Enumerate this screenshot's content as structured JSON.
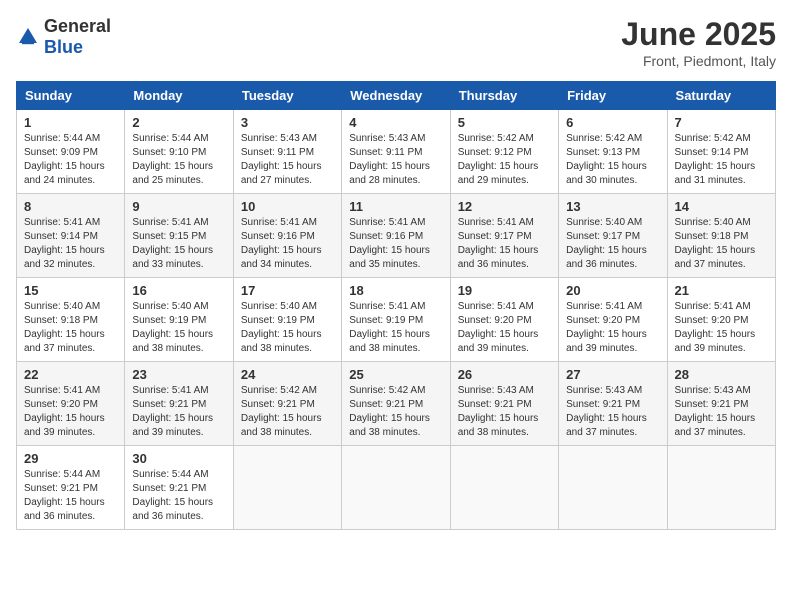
{
  "header": {
    "logo_general": "General",
    "logo_blue": "Blue",
    "month_title": "June 2025",
    "subtitle": "Front, Piedmont, Italy"
  },
  "days_of_week": [
    "Sunday",
    "Monday",
    "Tuesday",
    "Wednesday",
    "Thursday",
    "Friday",
    "Saturday"
  ],
  "weeks": [
    [
      {
        "day": "1",
        "sunrise": "5:44 AM",
        "sunset": "9:09 PM",
        "daylight": "15 hours and 24 minutes."
      },
      {
        "day": "2",
        "sunrise": "5:44 AM",
        "sunset": "9:10 PM",
        "daylight": "15 hours and 25 minutes."
      },
      {
        "day": "3",
        "sunrise": "5:43 AM",
        "sunset": "9:11 PM",
        "daylight": "15 hours and 27 minutes."
      },
      {
        "day": "4",
        "sunrise": "5:43 AM",
        "sunset": "9:11 PM",
        "daylight": "15 hours and 28 minutes."
      },
      {
        "day": "5",
        "sunrise": "5:42 AM",
        "sunset": "9:12 PM",
        "daylight": "15 hours and 29 minutes."
      },
      {
        "day": "6",
        "sunrise": "5:42 AM",
        "sunset": "9:13 PM",
        "daylight": "15 hours and 30 minutes."
      },
      {
        "day": "7",
        "sunrise": "5:42 AM",
        "sunset": "9:14 PM",
        "daylight": "15 hours and 31 minutes."
      }
    ],
    [
      {
        "day": "8",
        "sunrise": "5:41 AM",
        "sunset": "9:14 PM",
        "daylight": "15 hours and 32 minutes."
      },
      {
        "day": "9",
        "sunrise": "5:41 AM",
        "sunset": "9:15 PM",
        "daylight": "15 hours and 33 minutes."
      },
      {
        "day": "10",
        "sunrise": "5:41 AM",
        "sunset": "9:16 PM",
        "daylight": "15 hours and 34 minutes."
      },
      {
        "day": "11",
        "sunrise": "5:41 AM",
        "sunset": "9:16 PM",
        "daylight": "15 hours and 35 minutes."
      },
      {
        "day": "12",
        "sunrise": "5:41 AM",
        "sunset": "9:17 PM",
        "daylight": "15 hours and 36 minutes."
      },
      {
        "day": "13",
        "sunrise": "5:40 AM",
        "sunset": "9:17 PM",
        "daylight": "15 hours and 36 minutes."
      },
      {
        "day": "14",
        "sunrise": "5:40 AM",
        "sunset": "9:18 PM",
        "daylight": "15 hours and 37 minutes."
      }
    ],
    [
      {
        "day": "15",
        "sunrise": "5:40 AM",
        "sunset": "9:18 PM",
        "daylight": "15 hours and 37 minutes."
      },
      {
        "day": "16",
        "sunrise": "5:40 AM",
        "sunset": "9:19 PM",
        "daylight": "15 hours and 38 minutes."
      },
      {
        "day": "17",
        "sunrise": "5:40 AM",
        "sunset": "9:19 PM",
        "daylight": "15 hours and 38 minutes."
      },
      {
        "day": "18",
        "sunrise": "5:41 AM",
        "sunset": "9:19 PM",
        "daylight": "15 hours and 38 minutes."
      },
      {
        "day": "19",
        "sunrise": "5:41 AM",
        "sunset": "9:20 PM",
        "daylight": "15 hours and 39 minutes."
      },
      {
        "day": "20",
        "sunrise": "5:41 AM",
        "sunset": "9:20 PM",
        "daylight": "15 hours and 39 minutes."
      },
      {
        "day": "21",
        "sunrise": "5:41 AM",
        "sunset": "9:20 PM",
        "daylight": "15 hours and 39 minutes."
      }
    ],
    [
      {
        "day": "22",
        "sunrise": "5:41 AM",
        "sunset": "9:20 PM",
        "daylight": "15 hours and 39 minutes."
      },
      {
        "day": "23",
        "sunrise": "5:41 AM",
        "sunset": "9:21 PM",
        "daylight": "15 hours and 39 minutes."
      },
      {
        "day": "24",
        "sunrise": "5:42 AM",
        "sunset": "9:21 PM",
        "daylight": "15 hours and 38 minutes."
      },
      {
        "day": "25",
        "sunrise": "5:42 AM",
        "sunset": "9:21 PM",
        "daylight": "15 hours and 38 minutes."
      },
      {
        "day": "26",
        "sunrise": "5:43 AM",
        "sunset": "9:21 PM",
        "daylight": "15 hours and 38 minutes."
      },
      {
        "day": "27",
        "sunrise": "5:43 AM",
        "sunset": "9:21 PM",
        "daylight": "15 hours and 37 minutes."
      },
      {
        "day": "28",
        "sunrise": "5:43 AM",
        "sunset": "9:21 PM",
        "daylight": "15 hours and 37 minutes."
      }
    ],
    [
      {
        "day": "29",
        "sunrise": "5:44 AM",
        "sunset": "9:21 PM",
        "daylight": "15 hours and 36 minutes."
      },
      {
        "day": "30",
        "sunrise": "5:44 AM",
        "sunset": "9:21 PM",
        "daylight": "15 hours and 36 minutes."
      },
      null,
      null,
      null,
      null,
      null
    ]
  ]
}
